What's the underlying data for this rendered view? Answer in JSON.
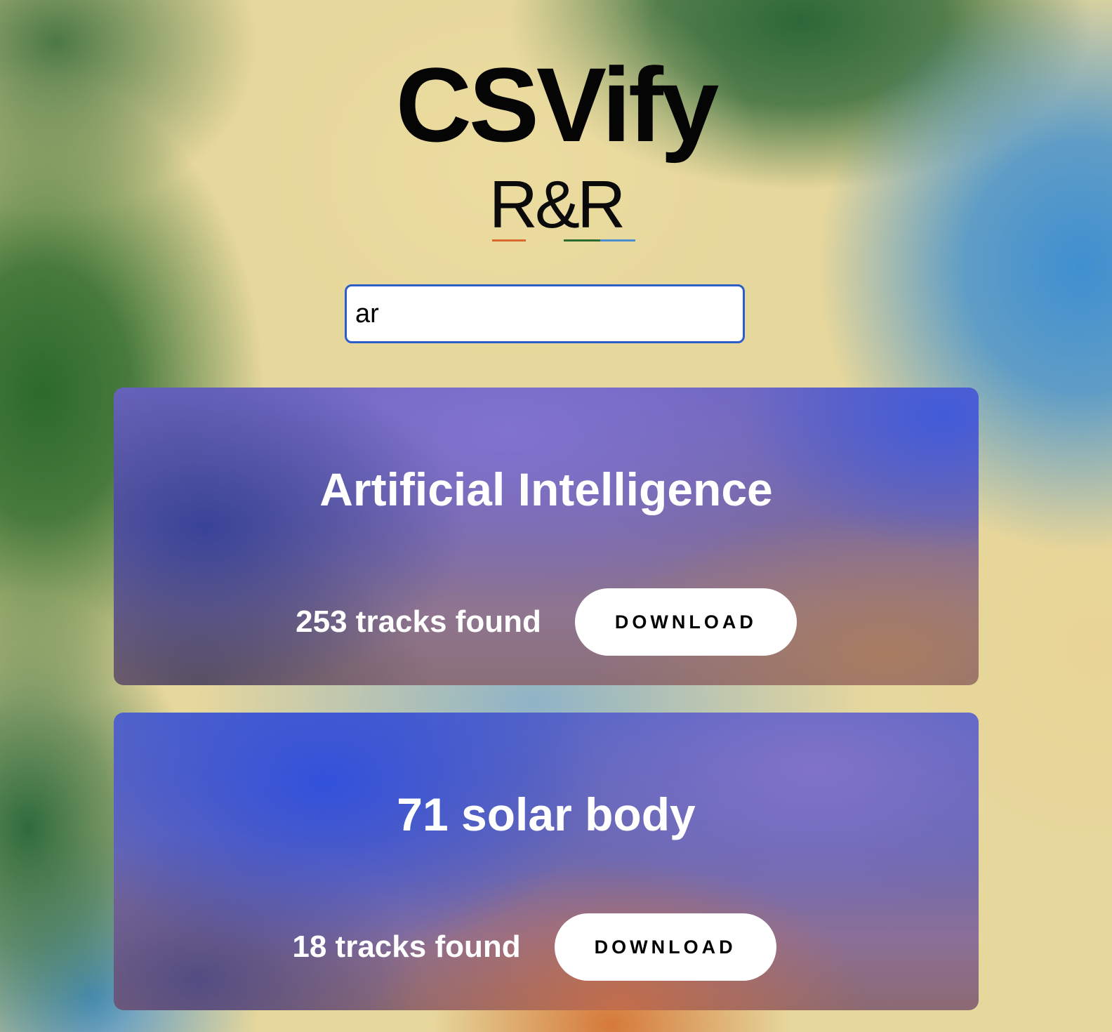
{
  "header": {
    "title": "CSVify",
    "subtitle": "R&R",
    "underline_colors": [
      "#d9692e",
      "#2e6b2e",
      "#4b8fd1"
    ]
  },
  "search": {
    "value": "ar",
    "placeholder": ""
  },
  "results": [
    {
      "title": "Artificial Intelligence",
      "tracks": "253 tracks found",
      "button_label": "DOWNLOAD"
    },
    {
      "title": "71 solar body",
      "tracks": "18 tracks found",
      "button_label": "DOWNLOAD"
    }
  ]
}
